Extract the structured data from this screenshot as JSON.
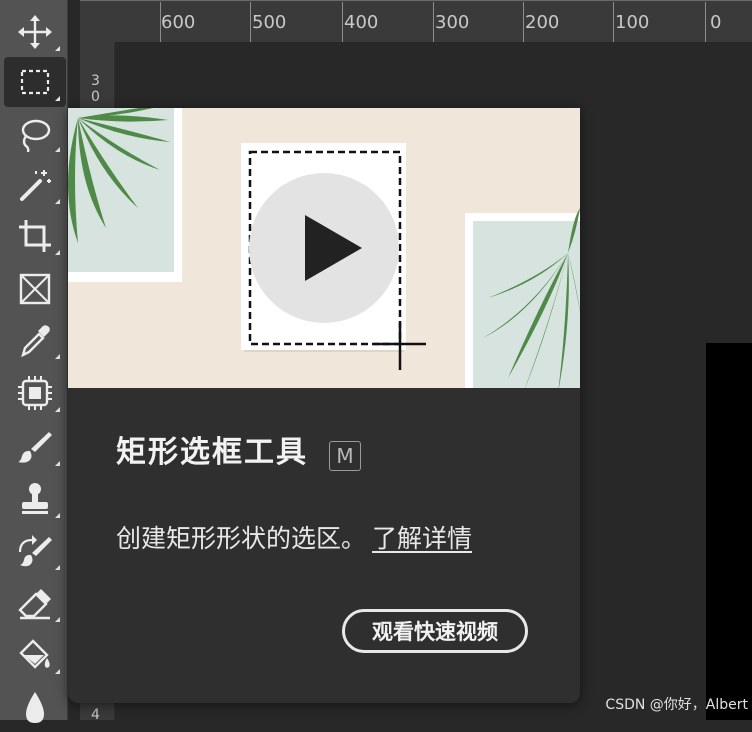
{
  "toolbar": {
    "tools": [
      {
        "name": "move-tool",
        "icon": "move-icon",
        "active": false
      },
      {
        "name": "rectangular-marquee-tool",
        "icon": "marquee-icon",
        "active": true
      },
      {
        "name": "lasso-tool",
        "icon": "lasso-icon",
        "active": false
      },
      {
        "name": "magic-wand-tool",
        "icon": "magic-wand-icon",
        "active": false
      },
      {
        "name": "crop-tool",
        "icon": "crop-icon",
        "active": false
      },
      {
        "name": "frame-tool",
        "icon": "frame-icon",
        "active": false
      },
      {
        "name": "eyedropper-tool",
        "icon": "eyedropper-icon",
        "active": false
      },
      {
        "name": "spot-healing-tool",
        "icon": "healing-icon",
        "active": false
      },
      {
        "name": "brush-tool",
        "icon": "brush-icon",
        "active": false
      },
      {
        "name": "clone-stamp-tool",
        "icon": "stamp-icon",
        "active": false
      },
      {
        "name": "history-brush-tool",
        "icon": "history-brush-icon",
        "active": false
      },
      {
        "name": "eraser-tool",
        "icon": "eraser-icon",
        "active": false
      },
      {
        "name": "paint-bucket-tool",
        "icon": "paint-bucket-icon",
        "active": false
      },
      {
        "name": "blur-tool",
        "icon": "blur-drop-icon",
        "active": false
      }
    ]
  },
  "ruler": {
    "horizontal_labels": [
      "600",
      "500",
      "400",
      "300",
      "200",
      "100",
      "0"
    ],
    "vertical_labels": [
      "3",
      "0",
      "4"
    ]
  },
  "tooltip": {
    "title": "矩形选框工具",
    "shortcut": "M",
    "description": "创建矩形形状的选区。",
    "learn_more": "了解详情",
    "video_button": "观看快速视频"
  },
  "watermark": "CSDN @你好，Albert",
  "colors": {
    "toolbar_bg": "#535353",
    "active_tool_bg": "#2d2d2d",
    "tooltip_bg": "#2f2f2f",
    "preview_bg": "#f1e6da",
    "leaf_green": "#4f8a48"
  }
}
